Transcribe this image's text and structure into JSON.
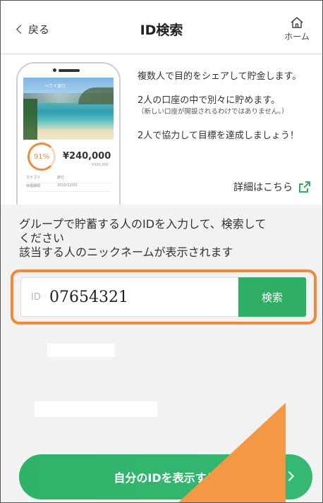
{
  "header": {
    "back_label": "戻る",
    "title": "ID検索",
    "home_label": "ホーム"
  },
  "promo": {
    "phone": {
      "title": "ハワイ旅行",
      "percent": "91%",
      "amount": "¥240,000",
      "target": "／¥300,000",
      "row1_label": "カテゴリ",
      "row1_value": "旅行",
      "row2_label": "目標期限",
      "row2_value": "2020/12/01"
    },
    "line1": "複数人で目的をシェアして貯金します。",
    "line2": "2人の口座の中で別々に貯めます。",
    "line2_note": "（新しい口座が開設されるわけではありません。）",
    "line3": "2人で協力して目標を達成しましょう！",
    "detail_link": "詳細はこちら"
  },
  "search": {
    "instruction_line1": "グループで貯蓄する人のIDを入力して、検索して",
    "instruction_line2": "ください",
    "instruction_line3": "該当する人のニックネームが表示されます",
    "id_label": "ID",
    "id_value": "07654321",
    "search_button": "検索"
  },
  "footer": {
    "show_id_button": "自分のIDを表示する"
  },
  "colors": {
    "accent_green": "#2eae63",
    "highlight_orange": "#f08a3a"
  }
}
